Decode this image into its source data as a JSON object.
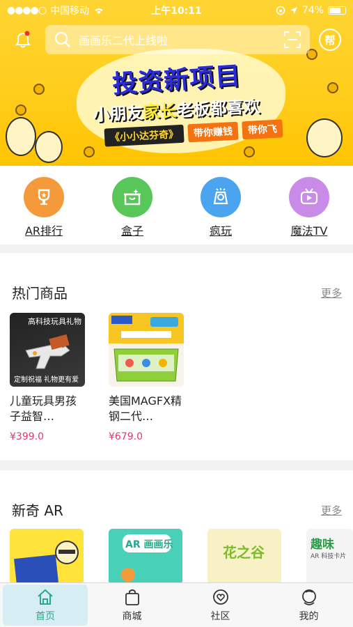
{
  "status_bar": {
    "carrier": "中国移动",
    "time": "上午10:11",
    "battery": "74%"
  },
  "header": {
    "search_placeholder": "画画乐二代上线啦",
    "help_label": "帮"
  },
  "banner": {
    "title": "投资新项目",
    "subtitle_part1": "小朋友",
    "subtitle_part2": "家长",
    "subtitle_part3": "老板都喜欢",
    "tag_main": "《小小达芬奇》",
    "tag_1": "带你赚钱",
    "tag_2": "带你飞"
  },
  "categories": [
    {
      "label": "AR排行",
      "icon": "trophy-icon",
      "color": "#f59a3a"
    },
    {
      "label": "盒子",
      "icon": "box-icon",
      "color": "#59c65a"
    },
    {
      "label": "疯玩",
      "icon": "ar-toy-icon",
      "color": "#4aa4ef"
    },
    {
      "label": "魔法TV",
      "icon": "tv-icon",
      "color": "#c98be8"
    }
  ],
  "hot_products": {
    "title": "热门商品",
    "more": "更多",
    "items": [
      {
        "name": "儿童玩具男孩子益智…",
        "price": "¥399.0",
        "thumb_top": "高科技玩具礼物",
        "thumb_bottom": "定制祝福 礼物更有爱"
      },
      {
        "name": "美国MAGFX精钢二代…",
        "price": "¥679.0"
      }
    ]
  },
  "ar_section": {
    "title": "新奇 AR",
    "more": "更多",
    "cards": [
      {
        "title": "",
        "color": "#ffe23a"
      },
      {
        "title": "AR 画画乐",
        "color": "#48d0b8"
      },
      {
        "title": "花之谷",
        "color": "#f9f1c6"
      },
      {
        "title": "趣味",
        "subtitle": "AR 科技卡片",
        "color": "#f4f4f4"
      }
    ]
  },
  "tabs": [
    {
      "label": "首页",
      "icon": "home-icon"
    },
    {
      "label": "商城",
      "icon": "shopping-bag-icon"
    },
    {
      "label": "社区",
      "icon": "community-icon"
    },
    {
      "label": "我的",
      "icon": "profile-icon"
    }
  ]
}
